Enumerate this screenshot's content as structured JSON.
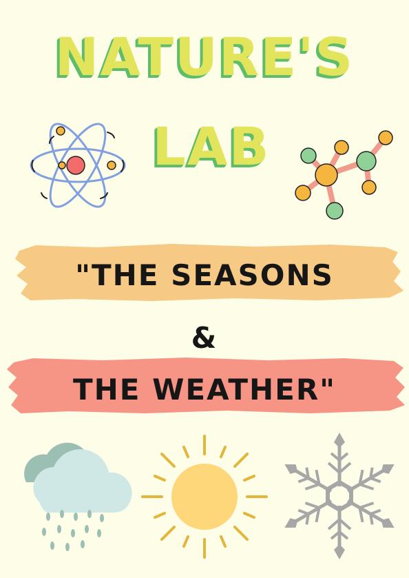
{
  "title": {
    "line1": "NATURE'S",
    "line2": "LAB"
  },
  "subtitle": {
    "line1": "\"THE SEASONS",
    "ampersand": "&",
    "line2": "THE WEATHER\""
  },
  "colors": {
    "background": "#fefde8",
    "title_fill": "#e2e45c",
    "title_shadow": "#5dbd68",
    "banner_top": "#f6c985",
    "banner_bottom": "#f69585",
    "text": "#161616"
  },
  "icons": [
    "atom-icon",
    "molecule-icon",
    "rain-cloud-icon",
    "sun-icon",
    "snowflake-icon"
  ]
}
